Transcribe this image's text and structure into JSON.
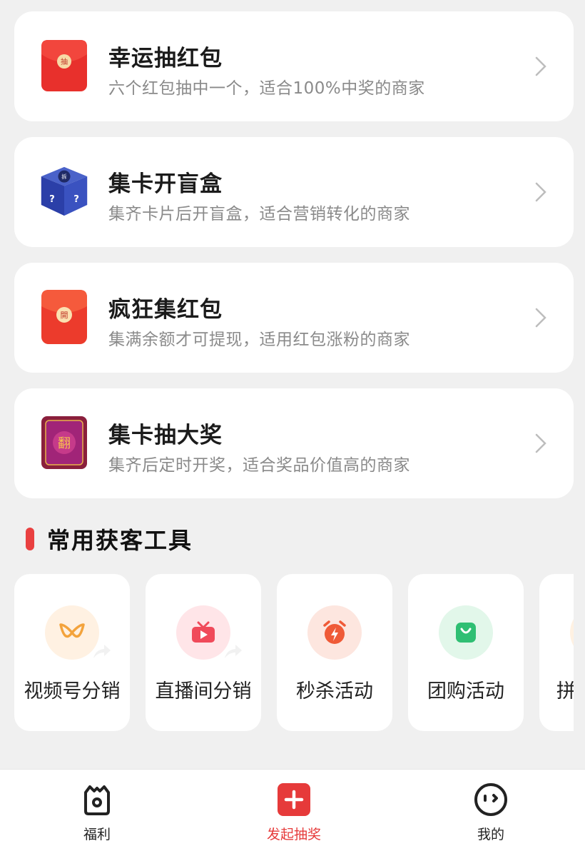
{
  "cards": [
    {
      "title": "幸运抽红包",
      "desc": "六个红包抽中一个，适合100%中奖的商家",
      "icon": "red-envelope-icon",
      "icon_text": "抽"
    },
    {
      "title": "集卡开盲盒",
      "desc": "集齐卡片后开盲盒，适合营销转化的商家",
      "icon": "blind-box-icon",
      "icon_text": "拆"
    },
    {
      "title": "疯狂集红包",
      "desc": "集满余额才可提现，适用红包涨粉的商家",
      "icon": "red-envelope-open-icon",
      "icon_text": "開"
    },
    {
      "title": "集卡抽大奖",
      "desc": "集齐后定时开奖，适合奖品价值高的商家",
      "icon": "flip-card-icon",
      "icon_text": "翻"
    }
  ],
  "section": {
    "title": "常用获客工具"
  },
  "tools": [
    {
      "label": "视频号分销",
      "icon": "video-channel-icon",
      "color": "#f3a33c",
      "bg": "#fff1e2"
    },
    {
      "label": "直播间分销",
      "icon": "live-tv-icon",
      "color": "#f04a5a",
      "bg": "#ffe5e8"
    },
    {
      "label": "秒杀活动",
      "icon": "alarm-clock-icon",
      "color": "#ef5a37",
      "bg": "#fde6df"
    },
    {
      "label": "团购活动",
      "icon": "shopping-bag-icon",
      "color": "#2fbf73",
      "bg": "#e2f7ea"
    },
    {
      "label": "拼团",
      "icon": "group-icon",
      "color": "#f3a33c",
      "bg": "#fff1e2"
    }
  ],
  "tabbar": [
    {
      "label": "福利",
      "icon": "gift-camera-icon"
    },
    {
      "label": "发起抽奖",
      "icon": "plus-icon"
    },
    {
      "label": "我的",
      "icon": "face-icon"
    }
  ],
  "colors": {
    "accent": "#e63a3a",
    "background": "#f0f0f0"
  }
}
